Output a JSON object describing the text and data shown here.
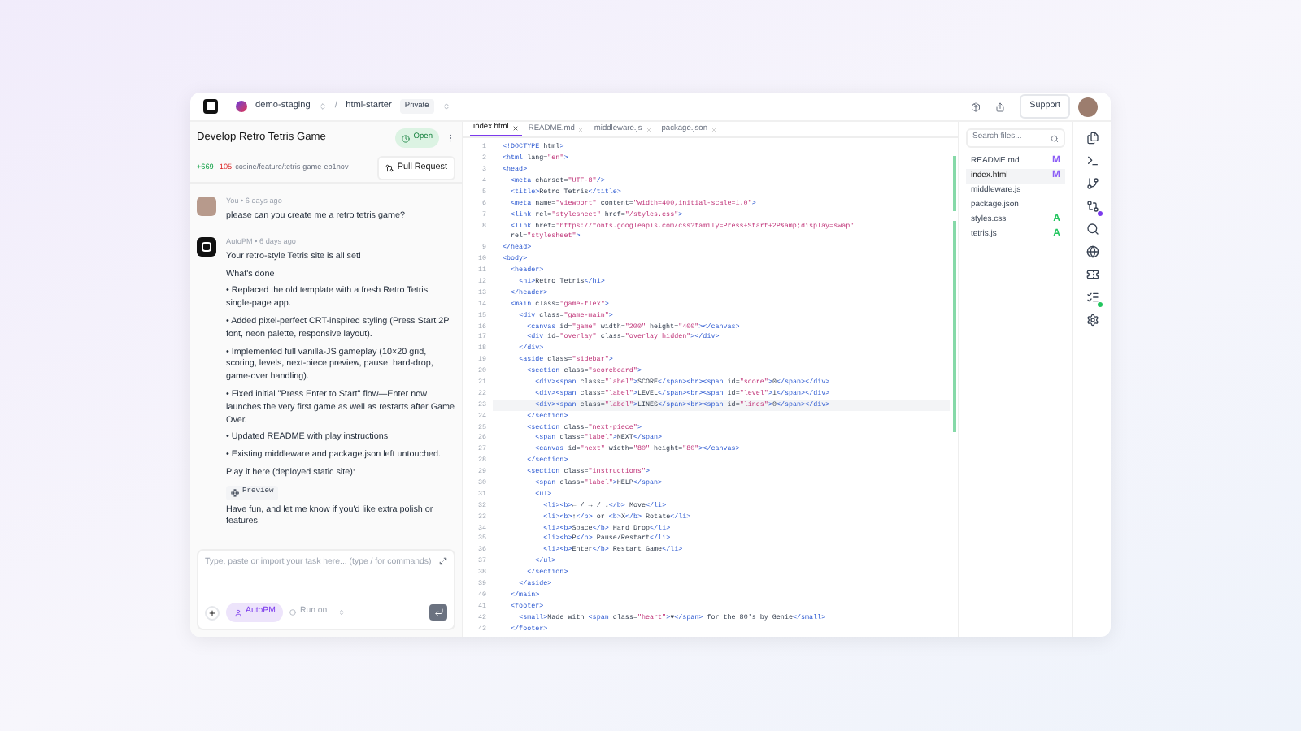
{
  "topbar": {
    "workspace": "demo-staging",
    "separator": "/",
    "repo": "html-starter",
    "visibility": "Private",
    "support": "Support"
  },
  "task": {
    "title": "Develop Retro Tetris Game",
    "status": "Open",
    "additions": "+669",
    "deletions": "-105",
    "branch": "cosine/feature/tetris-game-eb1nov",
    "pull_request": "Pull Request"
  },
  "messages": [
    {
      "kind": "user",
      "meta": "You • 6 days ago",
      "blocks": [
        {
          "kind": "text",
          "text": "please can you create me a retro tetris game?"
        }
      ]
    },
    {
      "kind": "bot",
      "meta": "AutoPM • 6 days ago",
      "blocks": [
        {
          "kind": "text",
          "text": "Your retro-style Tetris site is all set!"
        },
        {
          "kind": "text",
          "text": "What's done"
        },
        {
          "kind": "text",
          "text": "• Replaced the old template with a fresh Retro Tetris single-page app."
        },
        {
          "kind": "text",
          "text": "• Added pixel-perfect CRT-inspired styling (Press Start 2P font, neon palette, responsive layout)."
        },
        {
          "kind": "text",
          "text": "• Implemented full vanilla-JS gameplay (10×20 grid, scoring, levels, next-piece preview, pause, hard-drop, game-over handling)."
        },
        {
          "kind": "text",
          "text": "• Fixed initial \"Press Enter to Start\" flow—Enter now launches the very first game as well as restarts after Game Over."
        },
        {
          "kind": "text",
          "text": "• Updated README with play instructions."
        },
        {
          "kind": "text",
          "text": "• Existing middleware and package.json left untouched."
        },
        {
          "kind": "text",
          "text": "Play it here (deployed static site):"
        },
        {
          "kind": "link",
          "text": "Preview"
        },
        {
          "kind": "text",
          "text": "Have fun, and let me know if you'd like extra polish or features!"
        }
      ]
    }
  ],
  "composer": {
    "placeholder": "Type, paste or import your task here... (type / for commands)",
    "agent": "AutoPM",
    "run": "Run on..."
  },
  "tabs": [
    {
      "label": "index.html",
      "selected": true
    },
    {
      "label": "README.md",
      "selected": false
    },
    {
      "label": "middleware.js",
      "selected": false
    },
    {
      "label": "package.json",
      "selected": false
    }
  ],
  "code": [
    {
      "n": "1",
      "code": "<!DOCTYPE html>",
      "active": false
    },
    {
      "n": "2",
      "code": "<html lang=\"en\">",
      "active": false
    },
    {
      "n": "3",
      "code": "<head>",
      "active": false
    },
    {
      "n": "4",
      "code": "  <meta charset=\"UTF-8\"/>",
      "active": false
    },
    {
      "n": "5",
      "code": "  <title>Retro Tetris</title>",
      "active": false
    },
    {
      "n": "6",
      "code": "  <meta name=\"viewport\" content=\"width=400,initial-scale=1.0\">",
      "active": false
    },
    {
      "n": "7",
      "code": "  <link rel=\"stylesheet\" href=\"/styles.css\">",
      "active": false
    },
    {
      "n": "8",
      "code": "  <link href=\"https://fonts.googleapis.com/css?family=Press+Start+2P&amp;display=swap\"",
      "wrap": "  rel=\"stylesheet\">",
      "active": false
    },
    {
      "n": "9",
      "code": "</head>",
      "active": false
    },
    {
      "n": "10",
      "code": "<body>",
      "active": false
    },
    {
      "n": "11",
      "code": "  <header>",
      "active": false
    },
    {
      "n": "12",
      "code": "    <h1>Retro Tetris</h1>",
      "active": false
    },
    {
      "n": "13",
      "code": "  </header>",
      "active": false
    },
    {
      "n": "14",
      "code": "  <main class=\"game-flex\">",
      "active": false
    },
    {
      "n": "15",
      "code": "    <div class=\"game-main\">",
      "active": false
    },
    {
      "n": "16",
      "code": "      <canvas id=\"game\" width=\"200\" height=\"400\"></canvas>",
      "active": false
    },
    {
      "n": "17",
      "code": "      <div id=\"overlay\" class=\"overlay hidden\"></div>",
      "active": false
    },
    {
      "n": "18",
      "code": "    </div>",
      "active": false
    },
    {
      "n": "19",
      "code": "    <aside class=\"sidebar\">",
      "active": false
    },
    {
      "n": "20",
      "code": "      <section class=\"scoreboard\">",
      "active": false
    },
    {
      "n": "21",
      "code": "        <div><span class=\"label\">SCORE</span><br><span id=\"score\">0</span></div>",
      "active": false
    },
    {
      "n": "22",
      "code": "        <div><span class=\"label\">LEVEL</span><br><span id=\"level\">1</span></div>",
      "active": false
    },
    {
      "n": "23",
      "code": "        <div><span class=\"label\">LINES</span><br><span id=\"lines\">0</span></div>",
      "active": true
    },
    {
      "n": "24",
      "code": "      </section>",
      "active": false
    },
    {
      "n": "25",
      "code": "      <section class=\"next-piece\">",
      "active": false
    },
    {
      "n": "26",
      "code": "        <span class=\"label\">NEXT</span>",
      "active": false
    },
    {
      "n": "27",
      "code": "        <canvas id=\"next\" width=\"80\" height=\"80\"></canvas>",
      "active": false
    },
    {
      "n": "28",
      "code": "      </section>",
      "active": false
    },
    {
      "n": "29",
      "code": "      <section class=\"instructions\">",
      "active": false
    },
    {
      "n": "30",
      "code": "        <span class=\"label\">HELP</span>",
      "active": false
    },
    {
      "n": "31",
      "code": "        <ul>",
      "active": false
    },
    {
      "n": "32",
      "code": "          <li><b>← / → / ↓</b> Move</li>",
      "active": false
    },
    {
      "n": "33",
      "code": "          <li><b>↑</b> or <b>X</b> Rotate</li>",
      "active": false
    },
    {
      "n": "34",
      "code": "          <li><b>Space</b> Hard Drop</li>",
      "active": false
    },
    {
      "n": "35",
      "code": "          <li><b>P</b> Pause/Restart</li>",
      "active": false
    },
    {
      "n": "36",
      "code": "          <li><b>Enter</b> Restart Game</li>",
      "active": false
    },
    {
      "n": "37",
      "code": "        </ul>",
      "active": false
    },
    {
      "n": "38",
      "code": "      </section>",
      "active": false
    },
    {
      "n": "39",
      "code": "    </aside>",
      "active": false
    },
    {
      "n": "40",
      "code": "  </main>",
      "active": false
    },
    {
      "n": "41",
      "code": "  <footer>",
      "active": false
    },
    {
      "n": "42",
      "code": "    <small>Made with <span class=\"heart\">♥</span> for the 80's by Genie</small>",
      "active": false
    },
    {
      "n": "43",
      "code": "  </footer>",
      "active": false
    }
  ],
  "files": {
    "placeholder": "Search files...",
    "items": [
      {
        "name": "README.md",
        "status": "M",
        "color": "#8b5cf6",
        "selected": false
      },
      {
        "name": "index.html",
        "status": "M",
        "color": "#8b5cf6",
        "selected": true
      },
      {
        "name": "middleware.js",
        "selected": false
      },
      {
        "name": "package.json",
        "selected": false
      },
      {
        "name": "styles.css",
        "status": "A",
        "color": "#22c55e",
        "selected": false
      },
      {
        "name": "tetris.js",
        "status": "A",
        "color": "#22c55e",
        "selected": false
      }
    ]
  }
}
